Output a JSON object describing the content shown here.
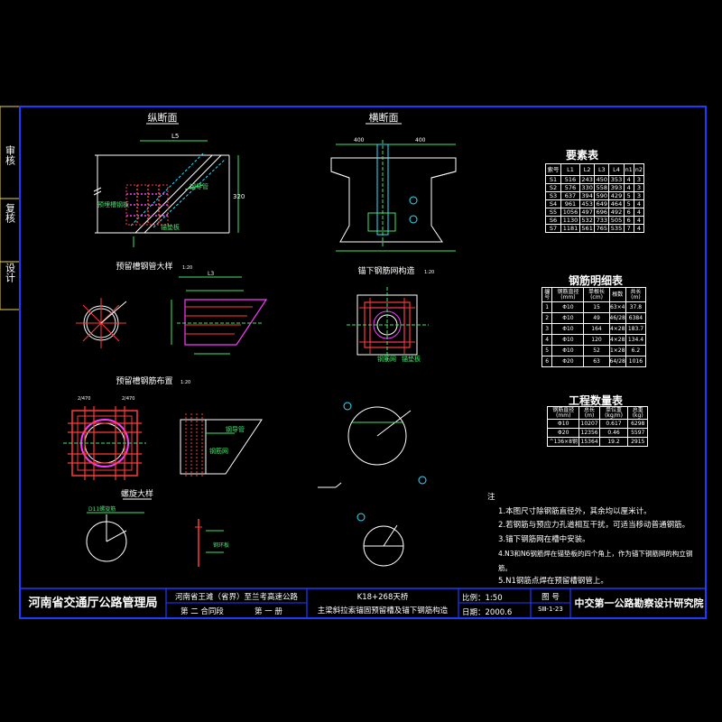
{
  "side_tabs": [
    "审核",
    "复核",
    "设计"
  ],
  "views": {
    "elevation_title": "纵断面",
    "cross_title": "横断面",
    "pipe_detail_title": "预留槽钢管大样",
    "pipe_detail_scale": "1:20",
    "anchor_bar_title": "锚下钢筋网构造",
    "anchor_bar_scale": "1:20",
    "rebar_layout_title": "预留槽钢筋布置",
    "rebar_layout_scale": "1:20",
    "spiral_title": "螺旋大样",
    "spiral_label": "D11螺旋筋",
    "pipe_label": "钢导管",
    "embed_label": "预埋槽钢板",
    "anchor_label": "锚垫板",
    "mesh_label": "钢筋网",
    "ring_label": "钢环板",
    "dim_L5": "L5",
    "dim_L3": "L3",
    "dim_400": "400",
    "dim_2470": "2/470"
  },
  "tables": {
    "params": {
      "title": "要素表",
      "headers": [
        "索号",
        "L1",
        "L2",
        "L3",
        "L4",
        "n1",
        "n2"
      ],
      "rows": [
        [
          "S1",
          "516",
          "243",
          "450",
          "353",
          "4",
          "3"
        ],
        [
          "S2",
          "576",
          "330",
          "558",
          "393",
          "4",
          "3"
        ],
        [
          "S3",
          "637",
          "394",
          "590",
          "429",
          "5",
          "3"
        ],
        [
          "S4",
          "961",
          "453",
          "649",
          "464",
          "5",
          "4"
        ],
        [
          "S5",
          "1056",
          "497",
          "696",
          "492",
          "6",
          "4"
        ],
        [
          "S6",
          "1130",
          "532",
          "733",
          "505",
          "6",
          "4"
        ],
        [
          "S7",
          "1181",
          "561",
          "765",
          "535",
          "7",
          "4"
        ]
      ]
    },
    "rebar": {
      "title": "钢筋明细表",
      "headers": [
        "编号",
        "钢筋直径(mm)",
        "单根长(cm)",
        "根数",
        "共长(m)"
      ],
      "rows": [
        [
          "1",
          "Φ10",
          "15",
          "63×4",
          "37.8"
        ],
        [
          "2",
          "Φ10",
          "49",
          "46/28",
          "6384"
        ],
        [
          "3",
          "Φ10",
          "164",
          "4×28",
          "183.7"
        ],
        [
          "4",
          "Φ10",
          "120",
          "4×28",
          "134.4"
        ],
        [
          "5",
          "Φ10",
          "52",
          "1×28",
          "6.2"
        ],
        [
          "6",
          "Φ20",
          "63",
          "64/28",
          "1016"
        ]
      ]
    },
    "quantity": {
      "title": "工程数量表",
      "headers": [
        "钢筋直径(mm)",
        "总长(m)",
        "单位重(kg/m)",
        "总重(kg)"
      ],
      "rows": [
        [
          "Φ10",
          "10207",
          "0.617",
          "6298"
        ],
        [
          "Φ20",
          "12356",
          "0.46",
          "5597"
        ],
        [
          "^136×8钢",
          "15364",
          "19.2",
          "2915"
        ]
      ]
    }
  },
  "notes": {
    "heading": "注",
    "items": [
      "1.本图尺寸除钢筋直径外，其余均以厘米计。",
      "2.若钢筋与预应力孔道相互干扰，可适当移动普通钢筋。",
      "3.锚下钢筋网在槽中安装。",
      "4.N3和N6钢筋焊在锚垫板的四个角上，作为锚下钢筋网的构立钢筋。",
      "5.N1钢筋点焊在预留槽钢管上。"
    ]
  },
  "title_block": {
    "org": "河南省交通厅公路管理局",
    "project_line1": "河南省王滩（省界）至兰考高速公路",
    "project_line2_a": "第 二 合同段",
    "project_line2_b": "第 一 册",
    "drawing_line1": "K18+268天桥",
    "drawing_line2": "主梁斜拉索锚固预留槽及锚下钢筋构造",
    "scale_label": "比例：",
    "scale_value": "1:50",
    "date_label": "日期：",
    "date_value": "2000.6",
    "fig_label": "图 号",
    "fig_value": "SⅢ-1-23",
    "institute": "中交第一公路勘察设计研究院"
  },
  "colors": {
    "border": "#1e3cff",
    "frame_left": "#e8d44d",
    "text": "#ffffff",
    "green": "#3ee86a",
    "cyan": "#32e0ff",
    "red": "#ff3a3a",
    "magenta": "#ff3aff",
    "yellow": "#ffff40"
  }
}
